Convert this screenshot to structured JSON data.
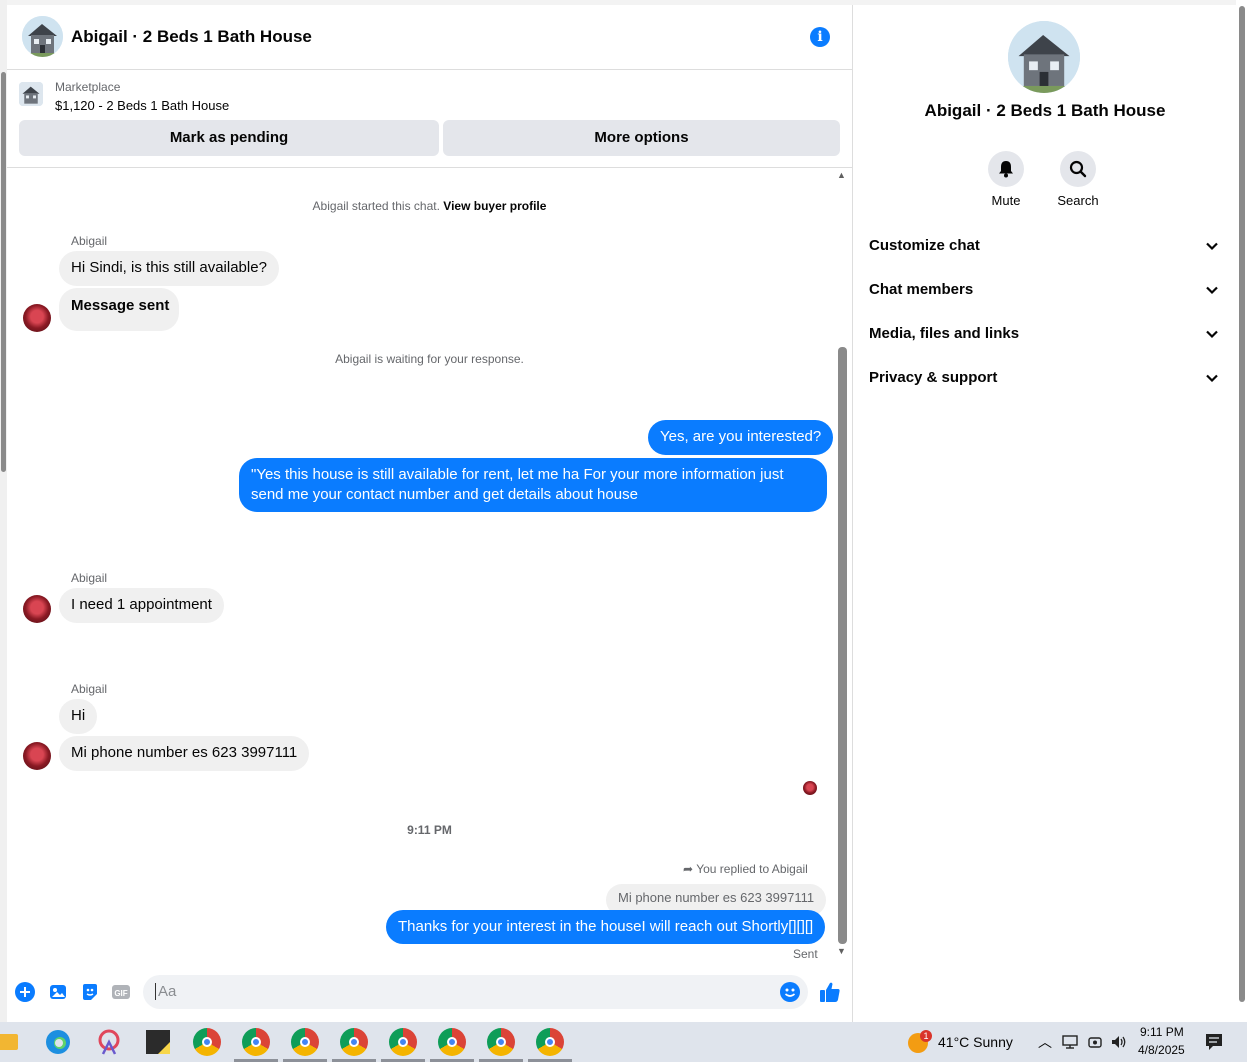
{
  "header": {
    "title": "Abigail · 2 Beds 1 Bath House"
  },
  "marketplace": {
    "label": "Marketplace",
    "listing": "$1,120 - 2 Beds 1 Bath House",
    "pending_button": "Mark as pending",
    "options_button": "More options"
  },
  "messages": {
    "started_prefix": "Abigail started this chat.",
    "started_link": "View buyer profile",
    "sender1": "Abigail",
    "m1": "Hi Sindi, is this still available?",
    "m2": "Message sent",
    "waiting": "Abigail is waiting for your response.",
    "o1": "Yes, are you interested?",
    "o2": "\"Yes this house is still available for rent, let me ha For  your  more  information  just  send  me   your  contact  number  and get details about house",
    "sender2": "Abigail",
    "m3": "I need 1 appointment",
    "sender3": "Abigail",
    "m4": "Hi",
    "m5": "Mi phone number es 623 3997111",
    "timestamp": "9:11 PM",
    "replied_label": "You replied to Abigail",
    "quoted": "Mi phone number es 623 3997111",
    "o3": "Thanks for your interest in the houseI will reach out Shortly[][][]",
    "status": "Sent"
  },
  "composer": {
    "placeholder": "Aa"
  },
  "right_panel": {
    "title": "Abigail · 2 Beds 1 Bath House",
    "mute_label": "Mute",
    "search_label": "Search",
    "sections": [
      "Customize chat",
      "Chat members",
      "Media, files and links",
      "Privacy & support"
    ]
  },
  "taskbar": {
    "weather_badge": "1",
    "weather": "41°C  Sunny",
    "time": "9:11 PM",
    "date": "4/8/2025"
  },
  "colors": {
    "accent": "#0a7cff",
    "bubble_in": "#f0f0f0"
  }
}
